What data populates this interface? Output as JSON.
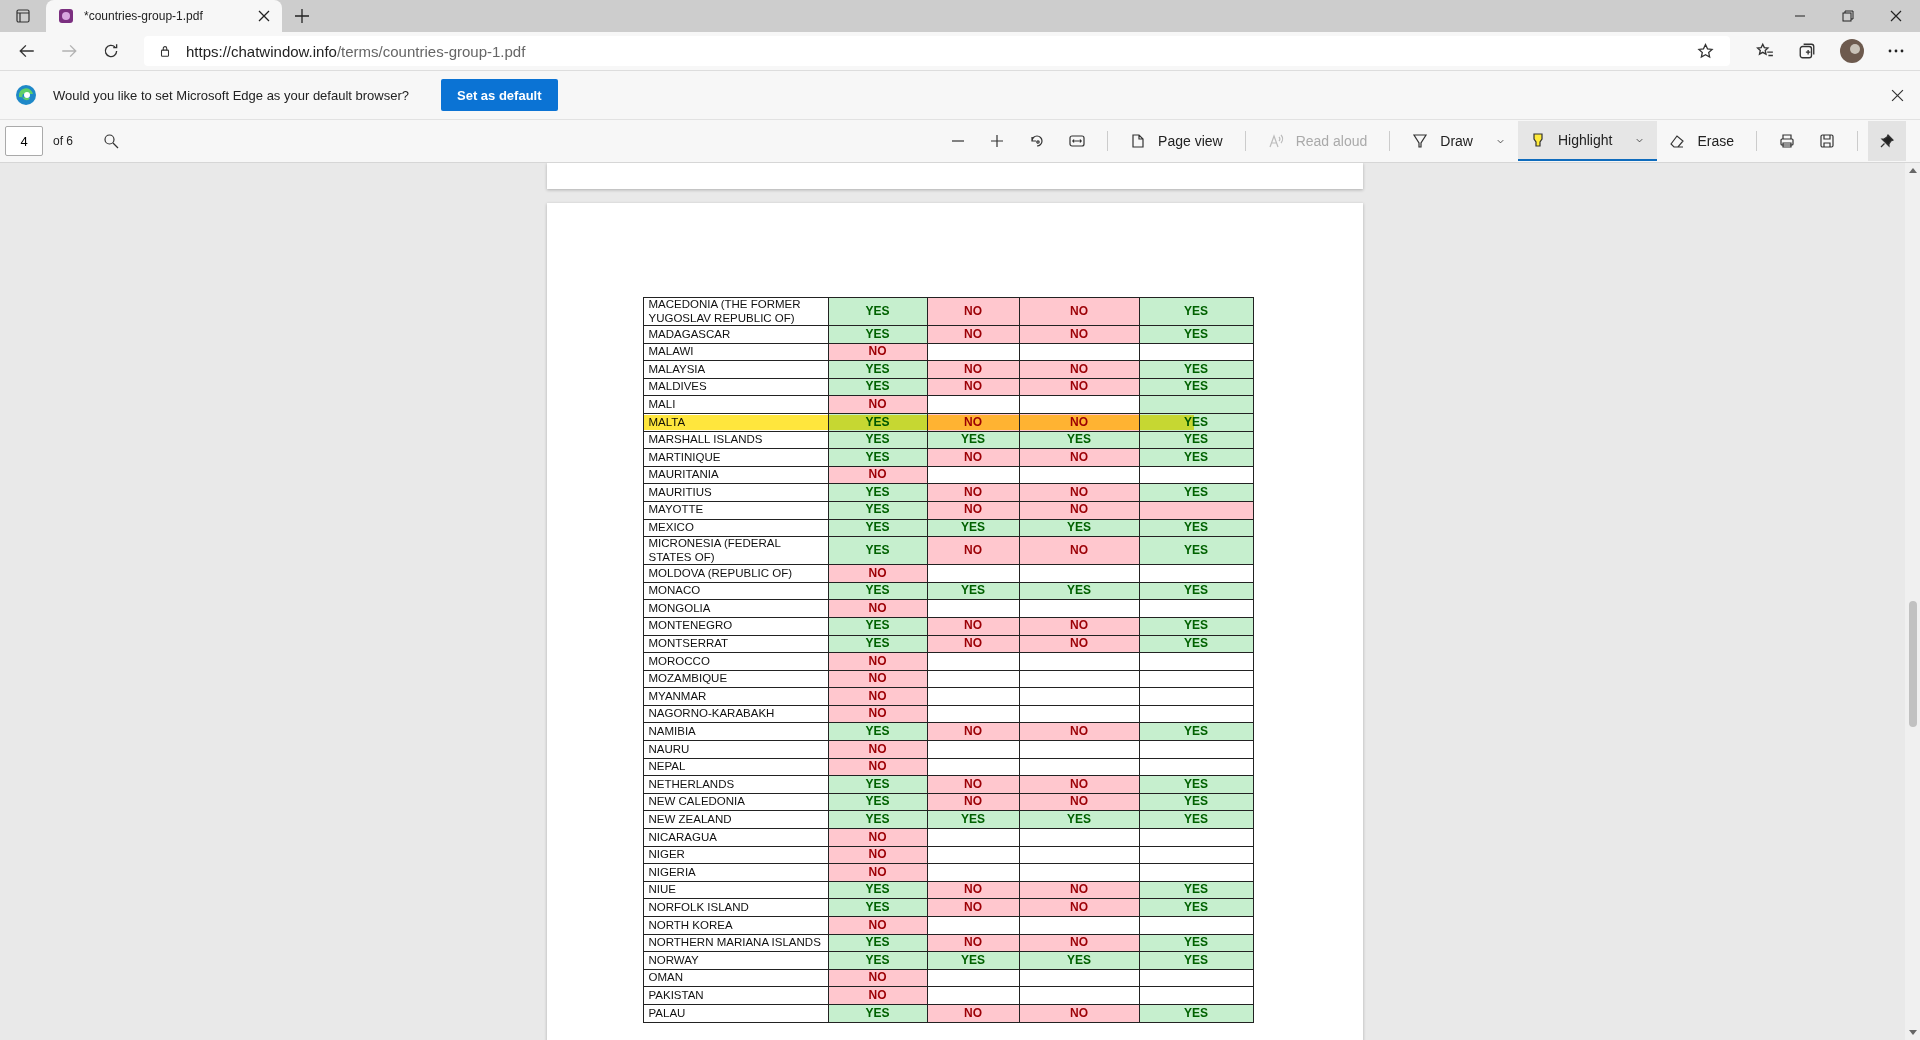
{
  "tab": {
    "title": "*countries-group-1.pdf",
    "selected": true
  },
  "address": {
    "host": "https://chatwindow.info",
    "path": "/terms/countries-group-1.pdf"
  },
  "infobar": {
    "message": "Would you like to set Microsoft Edge as your default browser?",
    "button": "Set as default"
  },
  "pdf_toolbar": {
    "page": "4",
    "page_count": "of 6",
    "tools": [
      {
        "kind": "page-view",
        "label": "Page view",
        "disabled": false,
        "selected": false
      },
      {
        "kind": "read-aloud",
        "label": "Read aloud",
        "disabled": true,
        "selected": false
      },
      {
        "kind": "draw",
        "label": "Draw",
        "disabled": false,
        "selected": false
      },
      {
        "kind": "highlight",
        "label": "Highlight",
        "disabled": false,
        "selected": true
      },
      {
        "kind": "erase",
        "label": "Erase",
        "disabled": false,
        "selected": false
      }
    ],
    "pinned": true
  },
  "table": {
    "rows": [
      {
        "country": "MACEDONIA (THE FORMER YUGOSLAV REPUBLIC OF)",
        "highlighted": false,
        "cells": [
          {
            "text": "YES",
            "color": "#c6efce"
          },
          {
            "text": "NO",
            "color": "#ffc7ce"
          },
          {
            "text": "NO",
            "color": "#ffc7ce"
          },
          {
            "text": "YES",
            "color": "#c6efce"
          }
        ]
      },
      {
        "country": "MADAGASCAR",
        "highlighted": false,
        "cells": [
          {
            "text": "YES",
            "color": "#c6efce"
          },
          {
            "text": "NO",
            "color": "#ffc7ce"
          },
          {
            "text": "NO",
            "color": "#ffc7ce"
          },
          {
            "text": "YES",
            "color": "#c6efce"
          }
        ]
      },
      {
        "country": "MALAWI",
        "highlighted": false,
        "cells": [
          {
            "text": "NO",
            "color": "#ffc7ce"
          },
          {
            "color": "#ffffff"
          },
          {
            "color": "#ffffff"
          },
          {
            "color": "#ffffff"
          }
        ]
      },
      {
        "country": "MALAYSIA",
        "highlighted": false,
        "cells": [
          {
            "text": "YES",
            "color": "#c6efce"
          },
          {
            "text": "NO",
            "color": "#ffc7ce"
          },
          {
            "text": "NO",
            "color": "#ffc7ce"
          },
          {
            "text": "YES",
            "color": "#c6efce"
          }
        ]
      },
      {
        "country": "MALDIVES",
        "highlighted": false,
        "cells": [
          {
            "text": "YES",
            "color": "#c6efce"
          },
          {
            "text": "NO",
            "color": "#ffc7ce"
          },
          {
            "text": "NO",
            "color": "#ffc7ce"
          },
          {
            "text": "YES",
            "color": "#c6efce"
          }
        ]
      },
      {
        "country": "MALI",
        "highlighted": false,
        "cells": [
          {
            "text": "NO",
            "color": "#ffc7ce"
          },
          {
            "color": "#ffffff"
          },
          {
            "color": "#ffffff"
          },
          {
            "color": "#c6efce"
          }
        ]
      },
      {
        "country": "MALTA",
        "highlighted": true,
        "cells": [
          {
            "text": "YES",
            "color": "#c6efce"
          },
          {
            "text": "NO",
            "color": "#ffc7ce"
          },
          {
            "text": "NO",
            "color": "#ffc7ce"
          },
          {
            "text": "YES",
            "color": "#c6efce"
          }
        ]
      },
      {
        "country": "MARSHALL ISLANDS",
        "highlighted": false,
        "cells": [
          {
            "text": "YES",
            "color": "#c6efce"
          },
          {
            "text": "YES",
            "color": "#c6efce"
          },
          {
            "text": "YES",
            "color": "#c6efce"
          },
          {
            "text": "YES",
            "color": "#c6efce"
          }
        ]
      },
      {
        "country": "MARTINIQUE",
        "highlighted": false,
        "cells": [
          {
            "text": "YES",
            "color": "#c6efce"
          },
          {
            "text": "NO",
            "color": "#ffc7ce"
          },
          {
            "text": "NO",
            "color": "#ffc7ce"
          },
          {
            "text": "YES",
            "color": "#c6efce"
          }
        ]
      },
      {
        "country": "MAURITANIA",
        "highlighted": false,
        "cells": [
          {
            "text": "NO",
            "color": "#ffc7ce"
          },
          {
            "color": "#ffffff"
          },
          {
            "color": "#ffffff"
          },
          {
            "color": "#ffffff"
          }
        ]
      },
      {
        "country": "MAURITIUS",
        "highlighted": false,
        "cells": [
          {
            "text": "YES",
            "color": "#c6efce"
          },
          {
            "text": "NO",
            "color": "#ffc7ce"
          },
          {
            "text": "NO",
            "color": "#ffc7ce"
          },
          {
            "text": "YES",
            "color": "#c6efce"
          }
        ]
      },
      {
        "country": "MAYOTTE",
        "highlighted": false,
        "cells": [
          {
            "text": "YES",
            "color": "#c6efce"
          },
          {
            "text": "NO",
            "color": "#ffc7ce"
          },
          {
            "text": "NO",
            "color": "#ffc7ce"
          },
          {
            "color": "#ffc7ce"
          }
        ]
      },
      {
        "country": "MEXICO",
        "highlighted": false,
        "cells": [
          {
            "text": "YES",
            "color": "#c6efce"
          },
          {
            "text": "YES",
            "color": "#c6efce"
          },
          {
            "text": "YES",
            "color": "#c6efce"
          },
          {
            "text": "YES",
            "color": "#c6efce"
          }
        ]
      },
      {
        "country": "MICRONESIA (FEDERAL STATES OF)",
        "highlighted": false,
        "cells": [
          {
            "text": "YES",
            "color": "#c6efce"
          },
          {
            "text": "NO",
            "color": "#ffc7ce"
          },
          {
            "text": "NO",
            "color": "#ffc7ce"
          },
          {
            "text": "YES",
            "color": "#c6efce"
          }
        ]
      },
      {
        "country": "MOLDOVA (REPUBLIC OF)",
        "highlighted": false,
        "cells": [
          {
            "text": "NO",
            "color": "#ffc7ce"
          },
          {
            "color": "#ffffff"
          },
          {
            "color": "#ffffff"
          },
          {
            "color": "#ffffff"
          }
        ]
      },
      {
        "country": "MONACO",
        "highlighted": false,
        "cells": [
          {
            "text": "YES",
            "color": "#c6efce"
          },
          {
            "text": "YES",
            "color": "#c6efce"
          },
          {
            "text": "YES",
            "color": "#c6efce"
          },
          {
            "text": "YES",
            "color": "#c6efce"
          }
        ]
      },
      {
        "country": "MONGOLIA",
        "highlighted": false,
        "cells": [
          {
            "text": "NO",
            "color": "#ffc7ce"
          },
          {
            "color": "#ffffff"
          },
          {
            "color": "#ffffff"
          },
          {
            "color": "#ffffff"
          }
        ]
      },
      {
        "country": "MONTENEGRO",
        "highlighted": false,
        "cells": [
          {
            "text": "YES",
            "color": "#c6efce"
          },
          {
            "text": "NO",
            "color": "#ffc7ce"
          },
          {
            "text": "NO",
            "color": "#ffc7ce"
          },
          {
            "text": "YES",
            "color": "#c6efce"
          }
        ]
      },
      {
        "country": "MONTSERRAT",
        "highlighted": false,
        "cells": [
          {
            "text": "YES",
            "color": "#c6efce"
          },
          {
            "text": "NO",
            "color": "#ffc7ce"
          },
          {
            "text": "NO",
            "color": "#ffc7ce"
          },
          {
            "text": "YES",
            "color": "#c6efce"
          }
        ]
      },
      {
        "country": "MOROCCO",
        "highlighted": false,
        "cells": [
          {
            "text": "NO",
            "color": "#ffc7ce"
          },
          {
            "color": "#ffffff"
          },
          {
            "color": "#ffffff"
          },
          {
            "color": "#ffffff"
          }
        ]
      },
      {
        "country": "MOZAMBIQUE",
        "highlighted": false,
        "cells": [
          {
            "text": "NO",
            "color": "#ffc7ce"
          },
          {
            "color": "#ffffff"
          },
          {
            "color": "#ffffff"
          },
          {
            "color": "#ffffff"
          }
        ]
      },
      {
        "country": "MYANMAR",
        "highlighted": false,
        "cells": [
          {
            "text": "NO",
            "color": "#ffc7ce"
          },
          {
            "color": "#ffffff"
          },
          {
            "color": "#ffffff"
          },
          {
            "color": "#ffffff"
          }
        ]
      },
      {
        "country": "NAGORNO-KARABAKH",
        "highlighted": false,
        "cells": [
          {
            "text": "NO",
            "color": "#ffc7ce"
          },
          {
            "color": "#ffffff"
          },
          {
            "color": "#ffffff"
          },
          {
            "color": "#ffffff"
          }
        ]
      },
      {
        "country": "NAMIBIA",
        "highlighted": false,
        "cells": [
          {
            "text": "YES",
            "color": "#c6efce"
          },
          {
            "text": "NO",
            "color": "#ffc7ce"
          },
          {
            "text": "NO",
            "color": "#ffc7ce"
          },
          {
            "text": "YES",
            "color": "#c6efce"
          }
        ]
      },
      {
        "country": "NAURU",
        "highlighted": false,
        "cells": [
          {
            "text": "NO",
            "color": "#ffc7ce"
          },
          {
            "color": "#ffffff"
          },
          {
            "color": "#ffffff"
          },
          {
            "color": "#ffffff"
          }
        ]
      },
      {
        "country": "NEPAL",
        "highlighted": false,
        "cells": [
          {
            "text": "NO",
            "color": "#ffc7ce"
          },
          {
            "color": "#ffffff"
          },
          {
            "color": "#ffffff"
          },
          {
            "color": "#ffffff"
          }
        ]
      },
      {
        "country": "NETHERLANDS",
        "highlighted": false,
        "cells": [
          {
            "text": "YES",
            "color": "#c6efce"
          },
          {
            "text": "NO",
            "color": "#ffc7ce"
          },
          {
            "text": "NO",
            "color": "#ffc7ce"
          },
          {
            "text": "YES",
            "color": "#c6efce"
          }
        ]
      },
      {
        "country": "NEW CALEDONIA",
        "highlighted": false,
        "cells": [
          {
            "text": "YES",
            "color": "#c6efce"
          },
          {
            "text": "NO",
            "color": "#ffc7ce"
          },
          {
            "text": "NO",
            "color": "#ffc7ce"
          },
          {
            "text": "YES",
            "color": "#c6efce"
          }
        ]
      },
      {
        "country": "NEW ZEALAND",
        "highlighted": false,
        "cells": [
          {
            "text": "YES",
            "color": "#c6efce"
          },
          {
            "text": "YES",
            "color": "#c6efce"
          },
          {
            "text": "YES",
            "color": "#c6efce"
          },
          {
            "text": "YES",
            "color": "#c6efce"
          }
        ]
      },
      {
        "country": "NICARAGUA",
        "highlighted": false,
        "cells": [
          {
            "text": "NO",
            "color": "#ffc7ce"
          },
          {
            "color": "#ffffff"
          },
          {
            "color": "#ffffff"
          },
          {
            "color": "#ffffff"
          }
        ]
      },
      {
        "country": "NIGER",
        "highlighted": false,
        "cells": [
          {
            "text": "NO",
            "color": "#ffc7ce"
          },
          {
            "color": "#ffffff"
          },
          {
            "color": "#ffffff"
          },
          {
            "color": "#ffffff"
          }
        ]
      },
      {
        "country": "NIGERIA",
        "highlighted": false,
        "cells": [
          {
            "text": "NO",
            "color": "#ffc7ce"
          },
          {
            "color": "#ffffff"
          },
          {
            "color": "#ffffff"
          },
          {
            "color": "#ffffff"
          }
        ]
      },
      {
        "country": "NIUE",
        "highlighted": false,
        "cells": [
          {
            "text": "YES",
            "color": "#c6efce"
          },
          {
            "text": "NO",
            "color": "#ffc7ce"
          },
          {
            "text": "NO",
            "color": "#ffc7ce"
          },
          {
            "text": "YES",
            "color": "#c6efce"
          }
        ]
      },
      {
        "country": "NORFOLK ISLAND",
        "highlighted": false,
        "cells": [
          {
            "text": "YES",
            "color": "#c6efce"
          },
          {
            "text": "NO",
            "color": "#ffc7ce"
          },
          {
            "text": "NO",
            "color": "#ffc7ce"
          },
          {
            "text": "YES",
            "color": "#c6efce"
          }
        ]
      },
      {
        "country": "NORTH KOREA",
        "highlighted": false,
        "cells": [
          {
            "text": "NO",
            "color": "#ffc7ce"
          },
          {
            "color": "#ffffff"
          },
          {
            "color": "#ffffff"
          },
          {
            "color": "#ffffff"
          }
        ]
      },
      {
        "country": "NORTHERN MARIANA ISLANDS",
        "highlighted": false,
        "cells": [
          {
            "text": "YES",
            "color": "#c6efce"
          },
          {
            "text": "NO",
            "color": "#ffc7ce"
          },
          {
            "text": "NO",
            "color": "#ffc7ce"
          },
          {
            "text": "YES",
            "color": "#c6efce"
          }
        ]
      },
      {
        "country": "NORWAY",
        "highlighted": false,
        "cells": [
          {
            "text": "YES",
            "color": "#c6efce"
          },
          {
            "text": "YES",
            "color": "#c6efce"
          },
          {
            "text": "YES",
            "color": "#c6efce"
          },
          {
            "text": "YES",
            "color": "#c6efce"
          }
        ]
      },
      {
        "country": "OMAN",
        "highlighted": false,
        "cells": [
          {
            "text": "NO",
            "color": "#ffc7ce"
          },
          {
            "color": "#ffffff"
          },
          {
            "color": "#ffffff"
          },
          {
            "color": "#ffffff"
          }
        ]
      },
      {
        "country": "PAKISTAN",
        "highlighted": false,
        "cells": [
          {
            "text": "NO",
            "color": "#ffc7ce"
          },
          {
            "color": "#ffffff"
          },
          {
            "color": "#ffffff"
          },
          {
            "color": "#ffffff"
          }
        ]
      },
      {
        "country": "PALAU",
        "highlighted": false,
        "cells": [
          {
            "text": "YES",
            "color": "#c6efce"
          },
          {
            "text": "NO",
            "color": "#ffc7ce"
          },
          {
            "text": "NO",
            "color": "#ffc7ce"
          },
          {
            "text": "YES",
            "color": "#c6efce"
          }
        ]
      }
    ]
  }
}
